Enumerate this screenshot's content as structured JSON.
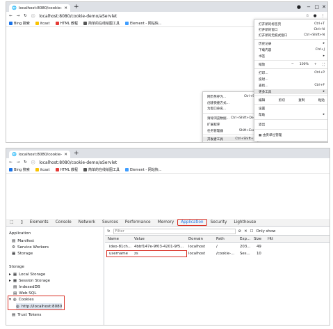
{
  "top_window": {
    "tab_title": "localhost:8080/cookie-demo/aS",
    "url": "localhost:8080/cookie-demo/aServlet",
    "bookmarks": [
      "Bing 搜索",
      "itcast",
      "HTML 教程",
      "简单的在线绘图工具",
      "Element - 网站快..."
    ],
    "chrome_menu": {
      "items": [
        {
          "label": "打开新的标签页",
          "shortcut": "Ctrl+T"
        },
        {
          "label": "打开新的窗口",
          "shortcut": "Ctrl+N"
        },
        {
          "label": "打开新的无痕式窗口",
          "shortcut": "Ctrl+Shift+N"
        },
        {
          "label": "历史记录",
          "shortcut": "▸"
        },
        {
          "label": "下载内容",
          "shortcut": "Ctrl+J"
        },
        {
          "label": "书签",
          "shortcut": "▸"
        },
        {
          "label": "缩放",
          "shortcut": ""
        },
        {
          "label": "打印...",
          "shortcut": "Ctrl+P"
        },
        {
          "label": "投射...",
          "shortcut": ""
        },
        {
          "label": "查找...",
          "shortcut": "Ctrl+F"
        },
        {
          "label": "更多工具",
          "shortcut": "▸"
        },
        {
          "label": "设置",
          "shortcut": ""
        },
        {
          "label": "帮助",
          "shortcut": "▸"
        },
        {
          "label": "退出",
          "shortcut": ""
        },
        {
          "label": "由贵单位管理",
          "shortcut": ""
        }
      ],
      "zoom_minus": "−",
      "zoom_value": "100%",
      "zoom_plus": "+",
      "edit_labels": [
        "编辑",
        "剪切",
        "复制",
        "粘贴"
      ]
    },
    "more_tools_menu": {
      "items": [
        {
          "label": "网页另存为...",
          "shortcut": "Ctrl+S"
        },
        {
          "label": "创建快捷方式...",
          "shortcut": ""
        },
        {
          "label": "为窗口命名...",
          "shortcut": ""
        },
        {
          "label": "清除浏览数据...",
          "shortcut": "Ctrl+Shift+Del"
        },
        {
          "label": "扩展程序",
          "shortcut": ""
        },
        {
          "label": "任务管理器",
          "shortcut": "Shift+Esc"
        },
        {
          "label": "开发者工具",
          "shortcut": "Ctrl+Shift+I"
        }
      ]
    }
  },
  "bottom_window": {
    "tab_title": "localhost:8080/cookie-demo/",
    "url": "localhost:8080/cookie-demo/aServlet",
    "bookmarks": [
      "Bing 搜索",
      "itcast",
      "HTML 教程",
      "简单的在线绘图工具",
      "Element - 网站快..."
    ],
    "devtools_tabs": [
      "Elements",
      "Console",
      "Network",
      "Sources",
      "Performance",
      "Memory",
      "Application",
      "Security",
      "Lighthouse"
    ],
    "selected_tab": "Application",
    "sidebar": {
      "app_heading": "Application",
      "app_items": [
        "Manifest",
        "Service Workers",
        "Storage"
      ],
      "storage_heading": "Storage",
      "storage_items": [
        "Local Storage",
        "Session Storage",
        "IndexedDB",
        "Web SQL",
        "Cookies"
      ],
      "cookie_origin": "http://localhost:8080",
      "trust_tokens": "Trust Tokens"
    },
    "filter_placeholder": "Filter",
    "only_show": "Only show",
    "columns": [
      "Name",
      "Value",
      "Domain",
      "Path",
      "Exp...",
      "Size",
      "Htt"
    ],
    "rows": [
      [
        "ideo-81ch...",
        "4bbf147e-9f03-4201-9f5...",
        "localhost",
        "/",
        "203...",
        "49",
        ""
      ],
      [
        "username",
        "zs",
        "localhost",
        "/cookie-...",
        "Ses...",
        "10",
        ""
      ]
    ]
  }
}
